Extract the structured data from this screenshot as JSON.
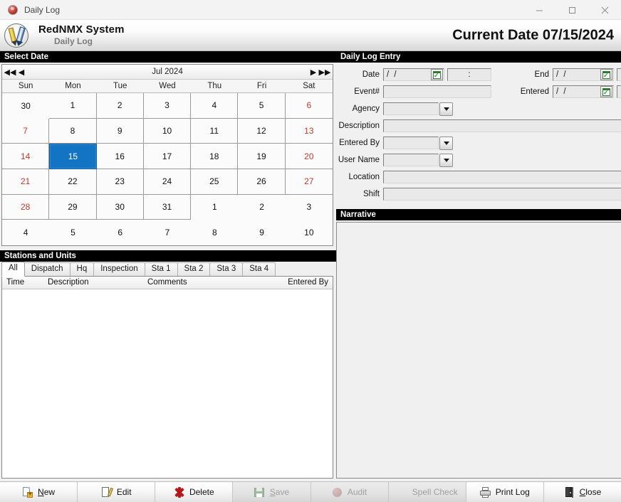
{
  "window": {
    "title": "Daily Log",
    "icon": "app-ball-icon",
    "minimize": "–",
    "maximize": "□",
    "close": "✕"
  },
  "header": {
    "app_title": "RedNMX System",
    "app_subtitle": "Daily Log",
    "current_date_label": "Current Date 07/15/2024"
  },
  "select_date": {
    "section_title": "Select Date",
    "month_label": "Jul 2024",
    "nav": {
      "prev_year": "◀◀",
      "prev_month": "◀",
      "next_month": "▶",
      "next_year": "▶▶"
    },
    "day_headers": [
      "Sun",
      "Mon",
      "Tue",
      "Wed",
      "Thu",
      "Fri",
      "Sat"
    ],
    "selected_day": "15",
    "weeks": [
      [
        {
          "n": "30",
          "weekend": false,
          "outside": false,
          "selected": false
        },
        {
          "n": "1",
          "weekend": false,
          "outside": false,
          "selected": false
        },
        {
          "n": "2",
          "weekend": false,
          "outside": false,
          "selected": false
        },
        {
          "n": "3",
          "weekend": false,
          "outside": false,
          "selected": false
        },
        {
          "n": "4",
          "weekend": false,
          "outside": false,
          "selected": false
        },
        {
          "n": "5",
          "weekend": false,
          "outside": false,
          "selected": false
        },
        {
          "n": "6",
          "weekend": true,
          "outside": false,
          "selected": false
        }
      ],
      [
        {
          "n": "7",
          "weekend": true,
          "outside": false,
          "selected": false
        },
        {
          "n": "8",
          "weekend": false,
          "outside": false,
          "selected": false
        },
        {
          "n": "9",
          "weekend": false,
          "outside": false,
          "selected": false
        },
        {
          "n": "10",
          "weekend": false,
          "outside": false,
          "selected": false
        },
        {
          "n": "11",
          "weekend": false,
          "outside": false,
          "selected": false
        },
        {
          "n": "12",
          "weekend": false,
          "outside": false,
          "selected": false
        },
        {
          "n": "13",
          "weekend": true,
          "outside": false,
          "selected": false
        }
      ],
      [
        {
          "n": "14",
          "weekend": true,
          "outside": false,
          "selected": false
        },
        {
          "n": "15",
          "weekend": false,
          "outside": false,
          "selected": true
        },
        {
          "n": "16",
          "weekend": false,
          "outside": false,
          "selected": false
        },
        {
          "n": "17",
          "weekend": false,
          "outside": false,
          "selected": false
        },
        {
          "n": "18",
          "weekend": false,
          "outside": false,
          "selected": false
        },
        {
          "n": "19",
          "weekend": false,
          "outside": false,
          "selected": false
        },
        {
          "n": "20",
          "weekend": true,
          "outside": false,
          "selected": false
        }
      ],
      [
        {
          "n": "21",
          "weekend": true,
          "outside": false,
          "selected": false
        },
        {
          "n": "22",
          "weekend": false,
          "outside": false,
          "selected": false
        },
        {
          "n": "23",
          "weekend": false,
          "outside": false,
          "selected": false
        },
        {
          "n": "24",
          "weekend": false,
          "outside": false,
          "selected": false
        },
        {
          "n": "25",
          "weekend": false,
          "outside": false,
          "selected": false
        },
        {
          "n": "26",
          "weekend": false,
          "outside": false,
          "selected": false
        },
        {
          "n": "27",
          "weekend": true,
          "outside": false,
          "selected": false
        }
      ],
      [
        {
          "n": "28",
          "weekend": true,
          "outside": false,
          "selected": false
        },
        {
          "n": "29",
          "weekend": false,
          "outside": false,
          "selected": false
        },
        {
          "n": "30",
          "weekend": false,
          "outside": false,
          "selected": false
        },
        {
          "n": "31",
          "weekend": false,
          "outside": false,
          "selected": false
        },
        {
          "n": "1",
          "weekend": false,
          "outside": true,
          "selected": false
        },
        {
          "n": "2",
          "weekend": false,
          "outside": true,
          "selected": false
        },
        {
          "n": "3",
          "weekend": false,
          "outside": true,
          "selected": false
        }
      ],
      [
        {
          "n": "4",
          "weekend": false,
          "outside": true,
          "selected": false
        },
        {
          "n": "5",
          "weekend": false,
          "outside": true,
          "selected": false
        },
        {
          "n": "6",
          "weekend": false,
          "outside": true,
          "selected": false
        },
        {
          "n": "7",
          "weekend": false,
          "outside": true,
          "selected": false
        },
        {
          "n": "8",
          "weekend": false,
          "outside": true,
          "selected": false
        },
        {
          "n": "9",
          "weekend": false,
          "outside": true,
          "selected": false
        },
        {
          "n": "10",
          "weekend": false,
          "outside": true,
          "selected": false
        }
      ]
    ]
  },
  "stations_and_units": {
    "section_title": "Stations and Units",
    "tabs": [
      {
        "label": "All",
        "active": true
      },
      {
        "label": "Dispatch",
        "active": false
      },
      {
        "label": "Hq",
        "active": false
      },
      {
        "label": "Inspection",
        "active": false
      },
      {
        "label": "Sta 1",
        "active": false
      },
      {
        "label": "Sta 2",
        "active": false
      },
      {
        "label": "Sta 3",
        "active": false
      },
      {
        "label": "Sta 4",
        "active": false
      }
    ],
    "columns": [
      "Time",
      "Description",
      "Comments",
      "Entered By"
    ],
    "rows": []
  },
  "daily_log_entry": {
    "section_title": "Daily Log Entry",
    "fields": {
      "date_label": "Date",
      "date_value": "/  /",
      "date_time_value": ":",
      "end_label": "End",
      "end_value": "/  /",
      "end_time_value": ":",
      "event_label": "Event#",
      "event_value": "",
      "entered_label": "Entered",
      "entered_value": "/  /",
      "entered_time_value": ":",
      "agency_label": "Agency",
      "agency_value": "",
      "description_label": "Description",
      "description_value": "",
      "entered_by_label": "Entered By",
      "entered_by_value": "",
      "user_name_label": "User Name",
      "user_name_value": "",
      "location_label": "Location",
      "location_value": "",
      "shift_label": "Shift",
      "shift_value": ""
    }
  },
  "narrative": {
    "section_title": "Narrative",
    "text": ""
  },
  "toolbar": {
    "buttons": [
      {
        "label_pre": "",
        "label_key": "N",
        "label_post": "ew",
        "icon": "new-page-icon",
        "disabled": false
      },
      {
        "label_pre": "Edit",
        "label_key": "",
        "label_post": "",
        "icon": "edit-pencil-icon",
        "disabled": false
      },
      {
        "label_pre": "Delete",
        "label_key": "",
        "label_post": "",
        "icon": "delete-x-icon",
        "disabled": false
      },
      {
        "label_pre": "",
        "label_key": "S",
        "label_post": "ave",
        "icon": "save-floppy-icon",
        "disabled": true
      },
      {
        "label_pre": "Audit",
        "label_key": "",
        "label_post": "",
        "icon": "audit-seal-icon",
        "disabled": true
      },
      {
        "label_pre": "Spell Check",
        "label_key": "",
        "label_post": "",
        "icon": "spellcheck-icon",
        "disabled": true
      },
      {
        "label_pre": "Print Log",
        "label_key": "",
        "label_post": "",
        "icon": "printer-icon",
        "disabled": false
      },
      {
        "label_pre": "",
        "label_key": "C",
        "label_post": "lose",
        "icon": "door-exit-icon",
        "disabled": false
      }
    ]
  },
  "colors": {
    "selection_blue": "#1474c4",
    "weekend_red": "#c0392b",
    "section_header_bg": "#000000",
    "window_bg": "#f0f0f0"
  }
}
